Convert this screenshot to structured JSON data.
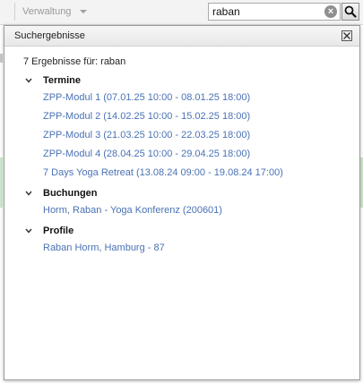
{
  "toolbar": {
    "menu_label": "Verwaltung",
    "search_value": "raban",
    "clear_symbol": "×"
  },
  "popup": {
    "title": "Suchergebnisse",
    "summary_prefix": "7 Ergebnisse für:",
    "summary_query": "raban",
    "groups": [
      {
        "label": "Termine",
        "items": [
          "ZPP-Modul 1 (07.01.25 10:00 - 08.01.25 18:00)",
          "ZPP-Modul 2 (14.02.25 10:00 - 15.02.25 18:00)",
          "ZPP-Modul 3 (21.03.25 10:00 - 22.03.25 18:00)",
          "ZPP-Modul 4 (28.04.25 10:00 - 29.04.25 18:00)",
          "7 Days Yoga Retreat (13.08.24 09:00 - 19.08.24 17:00)"
        ]
      },
      {
        "label": "Buchungen",
        "items": [
          "Horm, Raban - Yoga Konferenz (200601)"
        ]
      },
      {
        "label": "Profile",
        "items": [
          "Raban Horm, Hamburg - 87"
        ]
      }
    ]
  },
  "colors": {
    "link": "#4a72b5",
    "header_bg": "#ececec",
    "border": "#9b9b9b"
  }
}
